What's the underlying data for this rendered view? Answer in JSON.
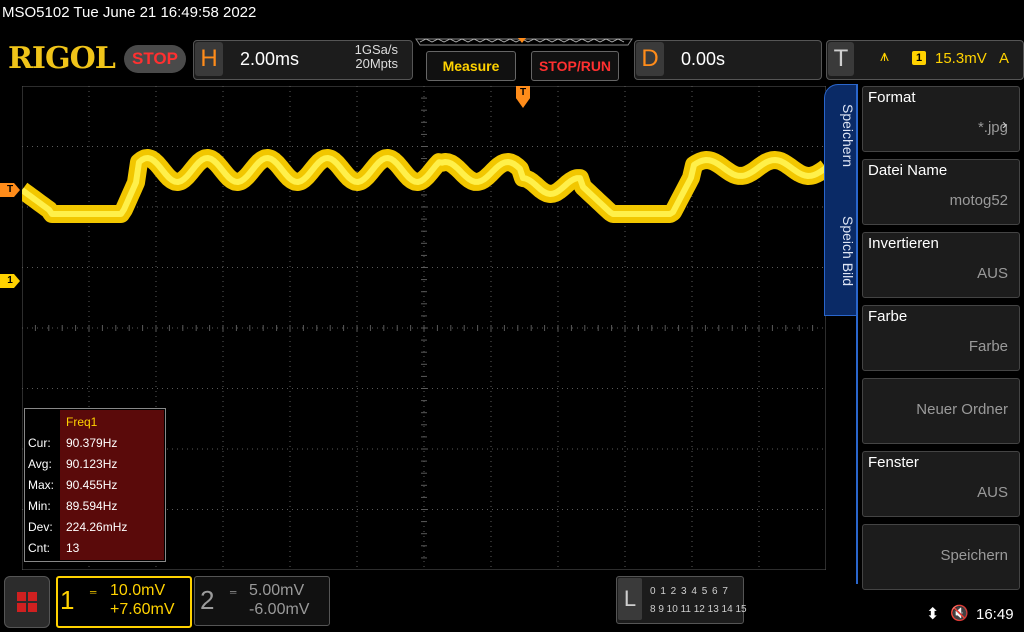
{
  "status_line": "MSO5102  Tue June 21 16:49:58 2022",
  "brand": "RIGOL",
  "run_state": "STOP",
  "horizontal": {
    "letter": "H",
    "timebase": "2.00ms",
    "sample_rate": "1GSa/s",
    "memory_depth": "20Mpts"
  },
  "buttons": {
    "measure": "Measure",
    "stop_run": "STOP/RUN"
  },
  "delay": {
    "letter": "D",
    "value": "0.00s"
  },
  "trigger": {
    "letter": "T",
    "source": "1",
    "level": "15.3mV",
    "mode": "A"
  },
  "markers": {
    "trigger_level": "T",
    "channel1": "1",
    "trigger_position": "T"
  },
  "measurement": {
    "title": "Freq1",
    "rows": [
      {
        "label": "Cur:",
        "value": "90.379Hz"
      },
      {
        "label": "Avg:",
        "value": "90.123Hz"
      },
      {
        "label": "Max:",
        "value": "90.455Hz"
      },
      {
        "label": "Min:",
        "value": "89.594Hz"
      },
      {
        "label": "Dev:",
        "value": "224.26mHz"
      },
      {
        "label": "Cnt:",
        "value": "13"
      }
    ]
  },
  "side_tabs": [
    "Speichern",
    "Speich Bild"
  ],
  "menu": [
    {
      "label": "Format",
      "value": "*.jpg"
    },
    {
      "label": "Datei Name",
      "value": "motog52"
    },
    {
      "label": "Invertieren",
      "value": "AUS"
    },
    {
      "label": "Farbe",
      "value": "Farbe"
    },
    {
      "label": "",
      "value": "Neuer Ordner"
    },
    {
      "label": "Fenster",
      "value": "AUS"
    },
    {
      "label": "",
      "value": "Speichern"
    }
  ],
  "channel1": {
    "number": "1",
    "scale": "10.0mV",
    "offset": "+7.60mV"
  },
  "channel2": {
    "number": "2",
    "scale": "5.00mV",
    "offset": "-6.00mV"
  },
  "logic": {
    "letter": "L",
    "row1": "0 1 2 3  4 5 6 7",
    "row2": "8 9 10 11 12 13 14 15"
  },
  "clock": "16:49",
  "colors": {
    "ch1": "#ffd200",
    "trigger": "#ff8c1a",
    "menu_accent": "#2a66cc"
  }
}
